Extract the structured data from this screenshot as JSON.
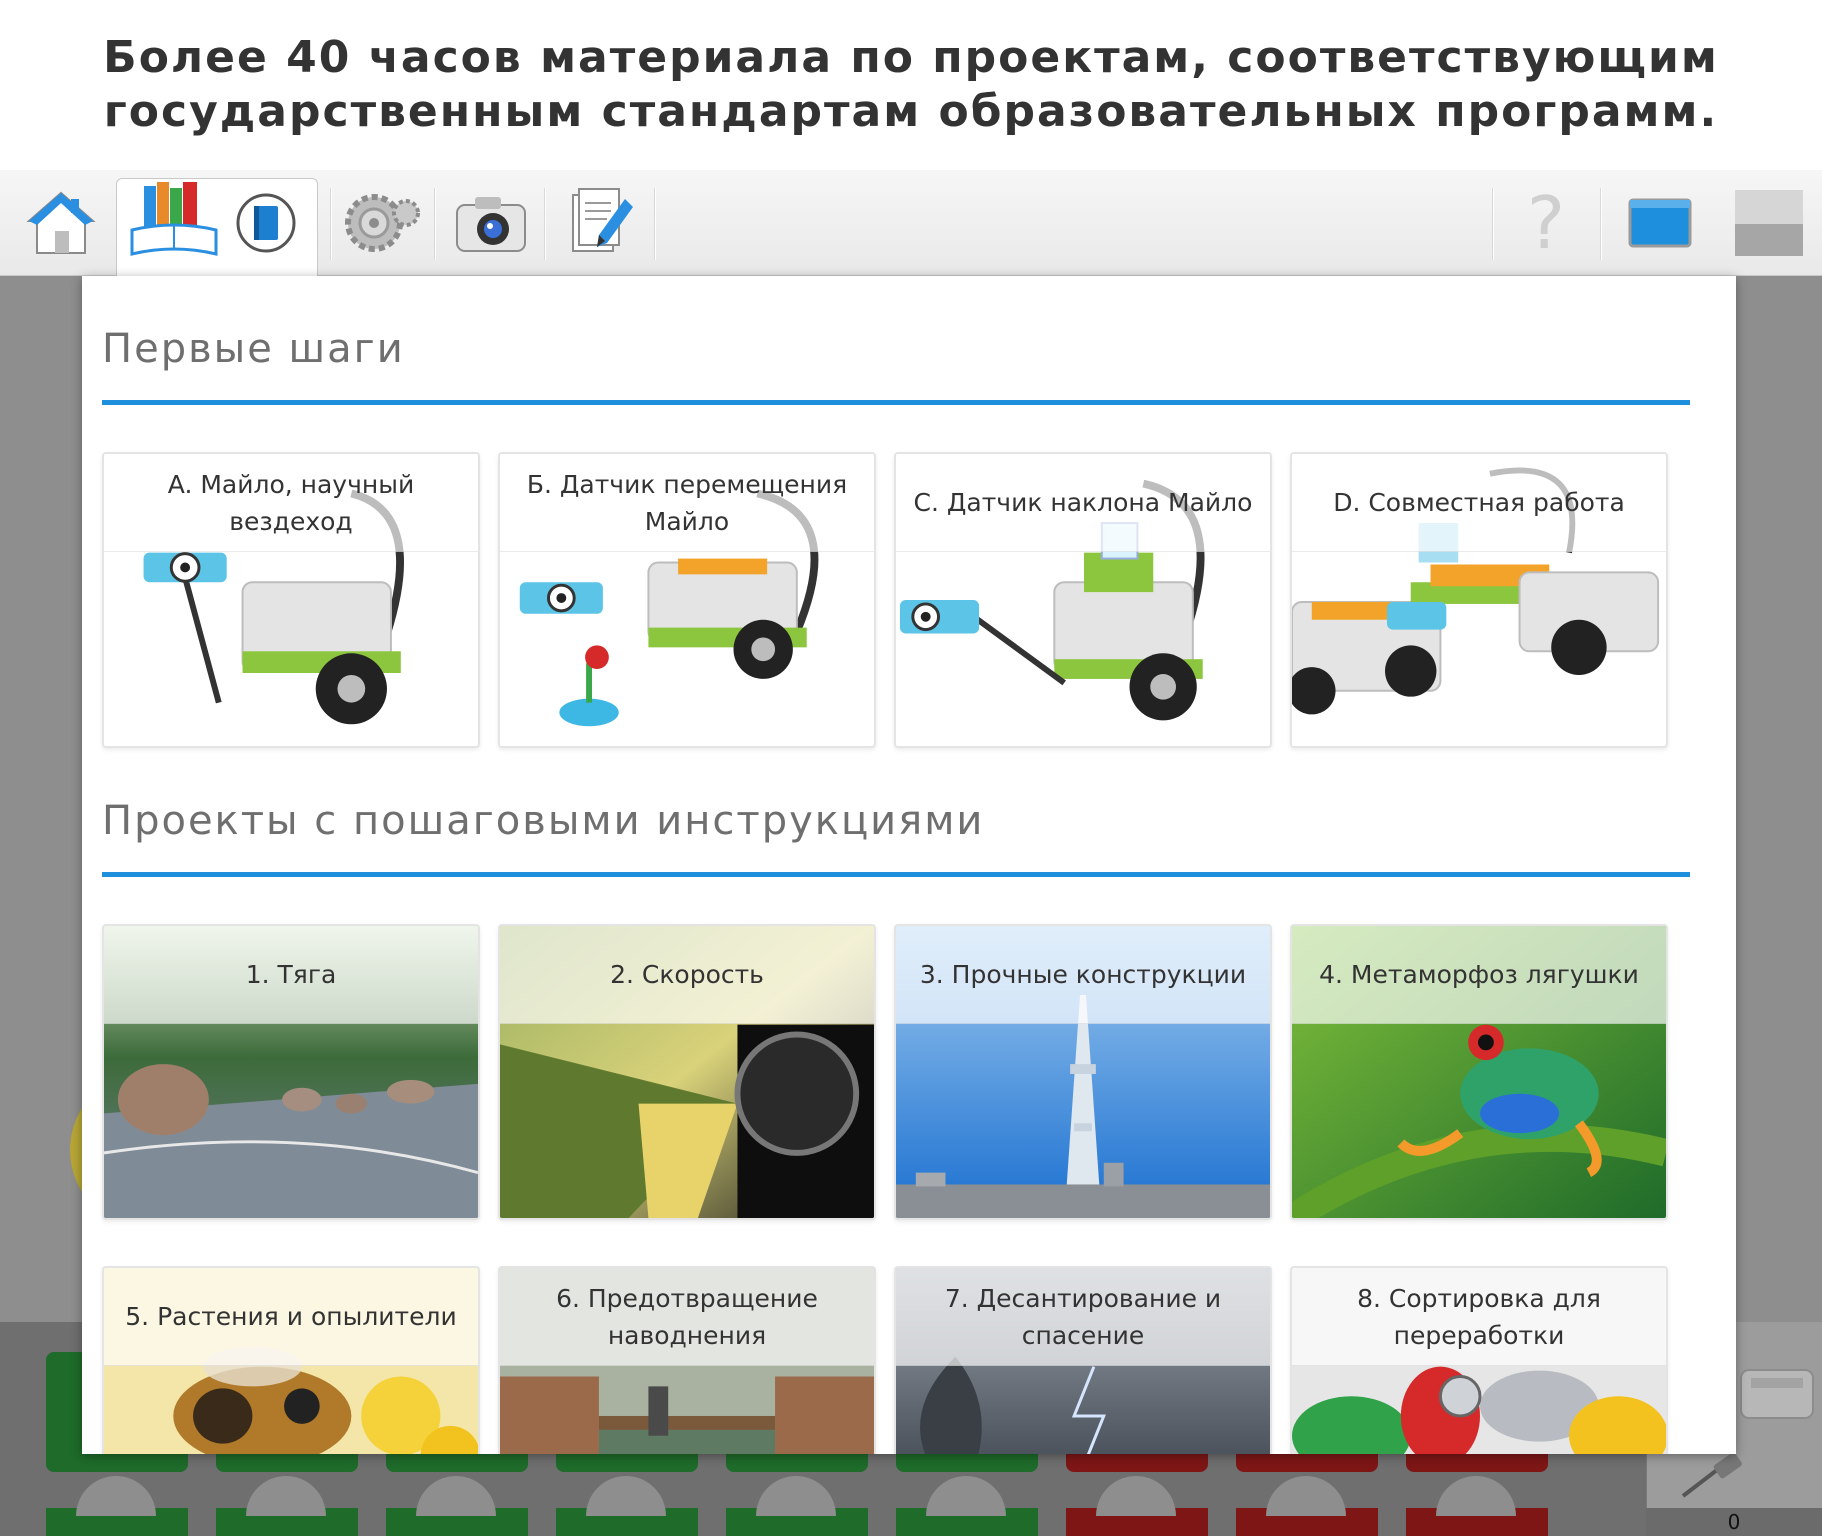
{
  "banner": {
    "line1": "Более 40 часов материала по проектам, соответствующим",
    "line2": "государственным стандартам образовательных программ."
  },
  "toolbar": {
    "icons": [
      "home-icon",
      "library-books-icon",
      "book-icon",
      "gears-icon",
      "camera-icon",
      "document-pencil-icon",
      "help-icon",
      "screen-icon",
      "window-toggle-icon"
    ],
    "help_label": "?"
  },
  "sections": {
    "first_steps": {
      "title": "Первые шаги",
      "cards": [
        {
          "label": "A. Майло, научный вездеход"
        },
        {
          "label": "Б. Датчик перемещения Майло"
        },
        {
          "label": "C. Датчик наклона Майло"
        },
        {
          "label": "D. Совместная работа"
        }
      ]
    },
    "projects": {
      "title": "Проекты с пошаговыми инструкциями",
      "cards": [
        {
          "label": "1. Тяга"
        },
        {
          "label": "2. Скорость"
        },
        {
          "label": "3. Прочные конструкции"
        },
        {
          "label": "4. Метаморфоз лягушки"
        },
        {
          "label": "5. Растения и опылители"
        },
        {
          "label": "6. Предотвращение наводнения"
        },
        {
          "label": "7. Десантирование и спасение"
        },
        {
          "label": "8. Сортировка для переработки"
        }
      ]
    }
  },
  "status": {
    "counter": "0"
  },
  "colors": {
    "accent": "#1e8fdc",
    "panel_bg": "#ffffff",
    "dim_bg": "#8e8e8e",
    "block_green": "#1e6b2a",
    "block_red": "#7e1616"
  }
}
